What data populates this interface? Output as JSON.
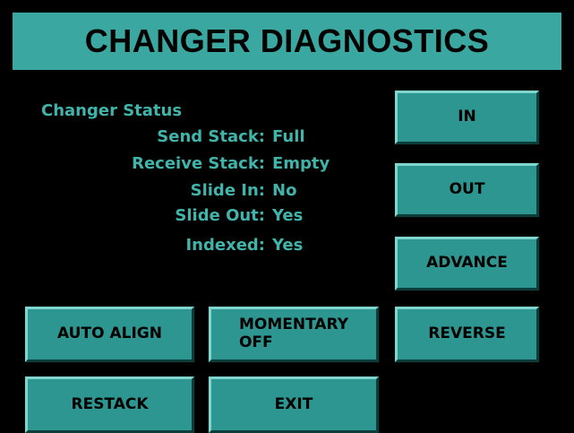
{
  "header": {
    "title": "CHANGER DIAGNOSTICS"
  },
  "status": {
    "heading": "Changer Status",
    "rows": [
      {
        "label": "Send Stack:",
        "value": "Full"
      },
      {
        "label": "Receive Stack:",
        "value": "Empty"
      },
      {
        "label": "Slide In:",
        "value": "No"
      },
      {
        "label": "Slide Out:",
        "value": "Yes"
      },
      {
        "label": "Indexed:",
        "value": "Yes"
      }
    ]
  },
  "buttons": {
    "in": "IN",
    "out": "OUT",
    "advance": "ADVANCE",
    "reverse": "REVERSE",
    "auto_align": "AUTO ALIGN",
    "momentary": "MOMENTARY\nOFF",
    "restack": "RESTACK",
    "exit": "EXIT"
  },
  "colors": {
    "background": "#000000",
    "accent_teal": "#3aa8a0",
    "status_text": "#40b4aa",
    "button_face": "#2d9690"
  }
}
